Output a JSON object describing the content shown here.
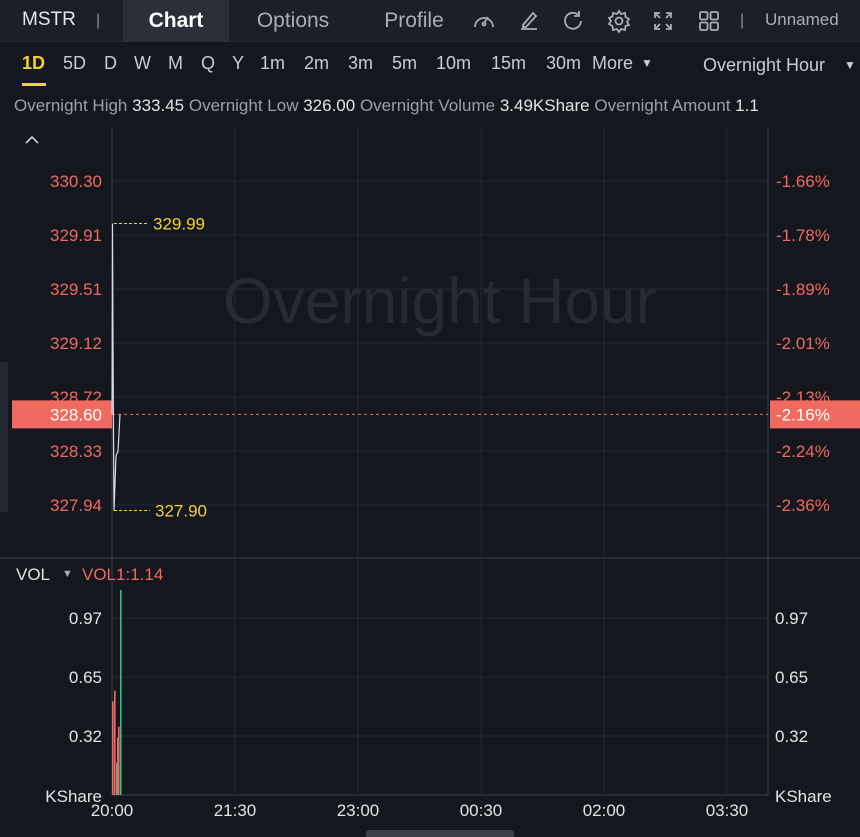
{
  "ticker": "MSTR",
  "tabs": [
    {
      "label": "Chart",
      "active": true
    },
    {
      "label": "Options",
      "active": false
    },
    {
      "label": "Profile",
      "active": false
    }
  ],
  "toolbar_icons": [
    "gauge-icon",
    "edit-icon",
    "refresh-icon",
    "settings-icon",
    "fullscreen-icon",
    "layout-grid-icon"
  ],
  "layout_name": "Unnamed",
  "periods": [
    "1D",
    "5D",
    "D",
    "W",
    "M",
    "Q",
    "Y",
    "1m",
    "2m",
    "3m",
    "5m",
    "10m",
    "15m",
    "30m"
  ],
  "active_period": "1D",
  "more_label": "More",
  "session_selector": "Overnight Hour",
  "stats": {
    "high_label": "Overnight High",
    "high_value": "333.45",
    "low_label": "Overnight Low",
    "low_value": "326.00",
    "volume_label": "Overnight Volume",
    "volume_value": "3.49KShare",
    "amount_label": "Overnight Amount",
    "amount_value": "1.1"
  },
  "watermark": "Overnight Hour",
  "colors": {
    "up": "#2ebd85",
    "down": "#f06a5f",
    "accent": "#f2d233",
    "price_line": "#d9dce2"
  },
  "chart_data": [
    {
      "type": "line",
      "name": "price",
      "y_ticks_left": [
        "330.30",
        "329.91",
        "329.51",
        "329.12",
        "328.72",
        "328.33",
        "327.94"
      ],
      "y_ticks_right": [
        "-1.66%",
        "-1.78%",
        "-1.89%",
        "-2.01%",
        "-2.13%",
        "-2.24%",
        "-2.36%"
      ],
      "x_ticks": [
        "20:00",
        "21:30",
        "23:00",
        "00:30",
        "02:00",
        "03:30"
      ],
      "ylim": [
        327.94,
        330.3
      ],
      "y": [
        328.6,
        329.99,
        329.1,
        328.45,
        327.9,
        328.3,
        328.33,
        328.6
      ],
      "current_price": "328.60",
      "current_change": "-2.16%",
      "max_marker": "329.99",
      "min_marker": "327.90"
    },
    {
      "type": "bar",
      "name": "VOL",
      "indicator_label": "VOL",
      "indicator_value": "VOL1:1.14",
      "unit": "KShare",
      "y_ticks": [
        "0.97",
        "0.65",
        "0.32"
      ],
      "ylim": [
        0,
        1.14
      ],
      "values": [
        0.52,
        0.58,
        0.18,
        0.32,
        0.38,
        1.14
      ],
      "colors": [
        "down",
        "down",
        "up",
        "down",
        "down",
        "up"
      ]
    }
  ]
}
